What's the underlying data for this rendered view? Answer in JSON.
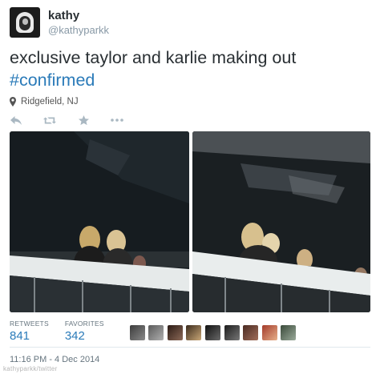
{
  "author": {
    "fullname": "kathy",
    "username": "@kathyparkk",
    "avatar_icon": "profile-avatar"
  },
  "tweet": {
    "text": "exclusive taylor and karlie making out",
    "hashtag": "#confirmed",
    "location": "Ridgefield, NJ"
  },
  "actions": {
    "reply_icon": "reply-icon",
    "retweet_icon": "retweet-icon",
    "favorite_icon": "star-icon",
    "more_icon": "more-icon"
  },
  "stats": {
    "retweets_label": "RETWEETS",
    "retweets_value": "841",
    "favorites_label": "FAVORITES",
    "favorites_value": "342"
  },
  "favoriters_count_shown": 9,
  "timestamp": "11:16 PM - 4 Dec 2014",
  "credit": "kathyparkk/twitter",
  "colors": {
    "link": "#2b7bb9",
    "text": "#292f33",
    "muted": "#8899a6"
  }
}
